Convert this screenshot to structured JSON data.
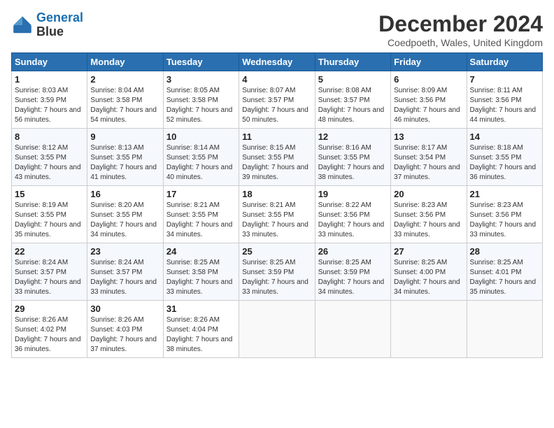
{
  "header": {
    "logo_line1": "General",
    "logo_line2": "Blue",
    "title": "December 2024",
    "subtitle": "Coedpoeth, Wales, United Kingdom"
  },
  "weekdays": [
    "Sunday",
    "Monday",
    "Tuesday",
    "Wednesday",
    "Thursday",
    "Friday",
    "Saturday"
  ],
  "weeks": [
    [
      {
        "day": "1",
        "sunrise": "8:03 AM",
        "sunset": "3:59 PM",
        "daylight": "7 hours and 56 minutes."
      },
      {
        "day": "2",
        "sunrise": "8:04 AM",
        "sunset": "3:58 PM",
        "daylight": "7 hours and 54 minutes."
      },
      {
        "day": "3",
        "sunrise": "8:05 AM",
        "sunset": "3:58 PM",
        "daylight": "7 hours and 52 minutes."
      },
      {
        "day": "4",
        "sunrise": "8:07 AM",
        "sunset": "3:57 PM",
        "daylight": "7 hours and 50 minutes."
      },
      {
        "day": "5",
        "sunrise": "8:08 AM",
        "sunset": "3:57 PM",
        "daylight": "7 hours and 48 minutes."
      },
      {
        "day": "6",
        "sunrise": "8:09 AM",
        "sunset": "3:56 PM",
        "daylight": "7 hours and 46 minutes."
      },
      {
        "day": "7",
        "sunrise": "8:11 AM",
        "sunset": "3:56 PM",
        "daylight": "7 hours and 44 minutes."
      }
    ],
    [
      {
        "day": "8",
        "sunrise": "8:12 AM",
        "sunset": "3:55 PM",
        "daylight": "7 hours and 43 minutes."
      },
      {
        "day": "9",
        "sunrise": "8:13 AM",
        "sunset": "3:55 PM",
        "daylight": "7 hours and 41 minutes."
      },
      {
        "day": "10",
        "sunrise": "8:14 AM",
        "sunset": "3:55 PM",
        "daylight": "7 hours and 40 minutes."
      },
      {
        "day": "11",
        "sunrise": "8:15 AM",
        "sunset": "3:55 PM",
        "daylight": "7 hours and 39 minutes."
      },
      {
        "day": "12",
        "sunrise": "8:16 AM",
        "sunset": "3:55 PM",
        "daylight": "7 hours and 38 minutes."
      },
      {
        "day": "13",
        "sunrise": "8:17 AM",
        "sunset": "3:54 PM",
        "daylight": "7 hours and 37 minutes."
      },
      {
        "day": "14",
        "sunrise": "8:18 AM",
        "sunset": "3:55 PM",
        "daylight": "7 hours and 36 minutes."
      }
    ],
    [
      {
        "day": "15",
        "sunrise": "8:19 AM",
        "sunset": "3:55 PM",
        "daylight": "7 hours and 35 minutes."
      },
      {
        "day": "16",
        "sunrise": "8:20 AM",
        "sunset": "3:55 PM",
        "daylight": "7 hours and 34 minutes."
      },
      {
        "day": "17",
        "sunrise": "8:21 AM",
        "sunset": "3:55 PM",
        "daylight": "7 hours and 34 minutes."
      },
      {
        "day": "18",
        "sunrise": "8:21 AM",
        "sunset": "3:55 PM",
        "daylight": "7 hours and 33 minutes."
      },
      {
        "day": "19",
        "sunrise": "8:22 AM",
        "sunset": "3:56 PM",
        "daylight": "7 hours and 33 minutes."
      },
      {
        "day": "20",
        "sunrise": "8:23 AM",
        "sunset": "3:56 PM",
        "daylight": "7 hours and 33 minutes."
      },
      {
        "day": "21",
        "sunrise": "8:23 AM",
        "sunset": "3:56 PM",
        "daylight": "7 hours and 33 minutes."
      }
    ],
    [
      {
        "day": "22",
        "sunrise": "8:24 AM",
        "sunset": "3:57 PM",
        "daylight": "7 hours and 33 minutes."
      },
      {
        "day": "23",
        "sunrise": "8:24 AM",
        "sunset": "3:57 PM",
        "daylight": "7 hours and 33 minutes."
      },
      {
        "day": "24",
        "sunrise": "8:25 AM",
        "sunset": "3:58 PM",
        "daylight": "7 hours and 33 minutes."
      },
      {
        "day": "25",
        "sunrise": "8:25 AM",
        "sunset": "3:59 PM",
        "daylight": "7 hours and 33 minutes."
      },
      {
        "day": "26",
        "sunrise": "8:25 AM",
        "sunset": "3:59 PM",
        "daylight": "7 hours and 34 minutes."
      },
      {
        "day": "27",
        "sunrise": "8:25 AM",
        "sunset": "4:00 PM",
        "daylight": "7 hours and 34 minutes."
      },
      {
        "day": "28",
        "sunrise": "8:25 AM",
        "sunset": "4:01 PM",
        "daylight": "7 hours and 35 minutes."
      }
    ],
    [
      {
        "day": "29",
        "sunrise": "8:26 AM",
        "sunset": "4:02 PM",
        "daylight": "7 hours and 36 minutes."
      },
      {
        "day": "30",
        "sunrise": "8:26 AM",
        "sunset": "4:03 PM",
        "daylight": "7 hours and 37 minutes."
      },
      {
        "day": "31",
        "sunrise": "8:26 AM",
        "sunset": "4:04 PM",
        "daylight": "7 hours and 38 minutes."
      },
      null,
      null,
      null,
      null
    ]
  ]
}
